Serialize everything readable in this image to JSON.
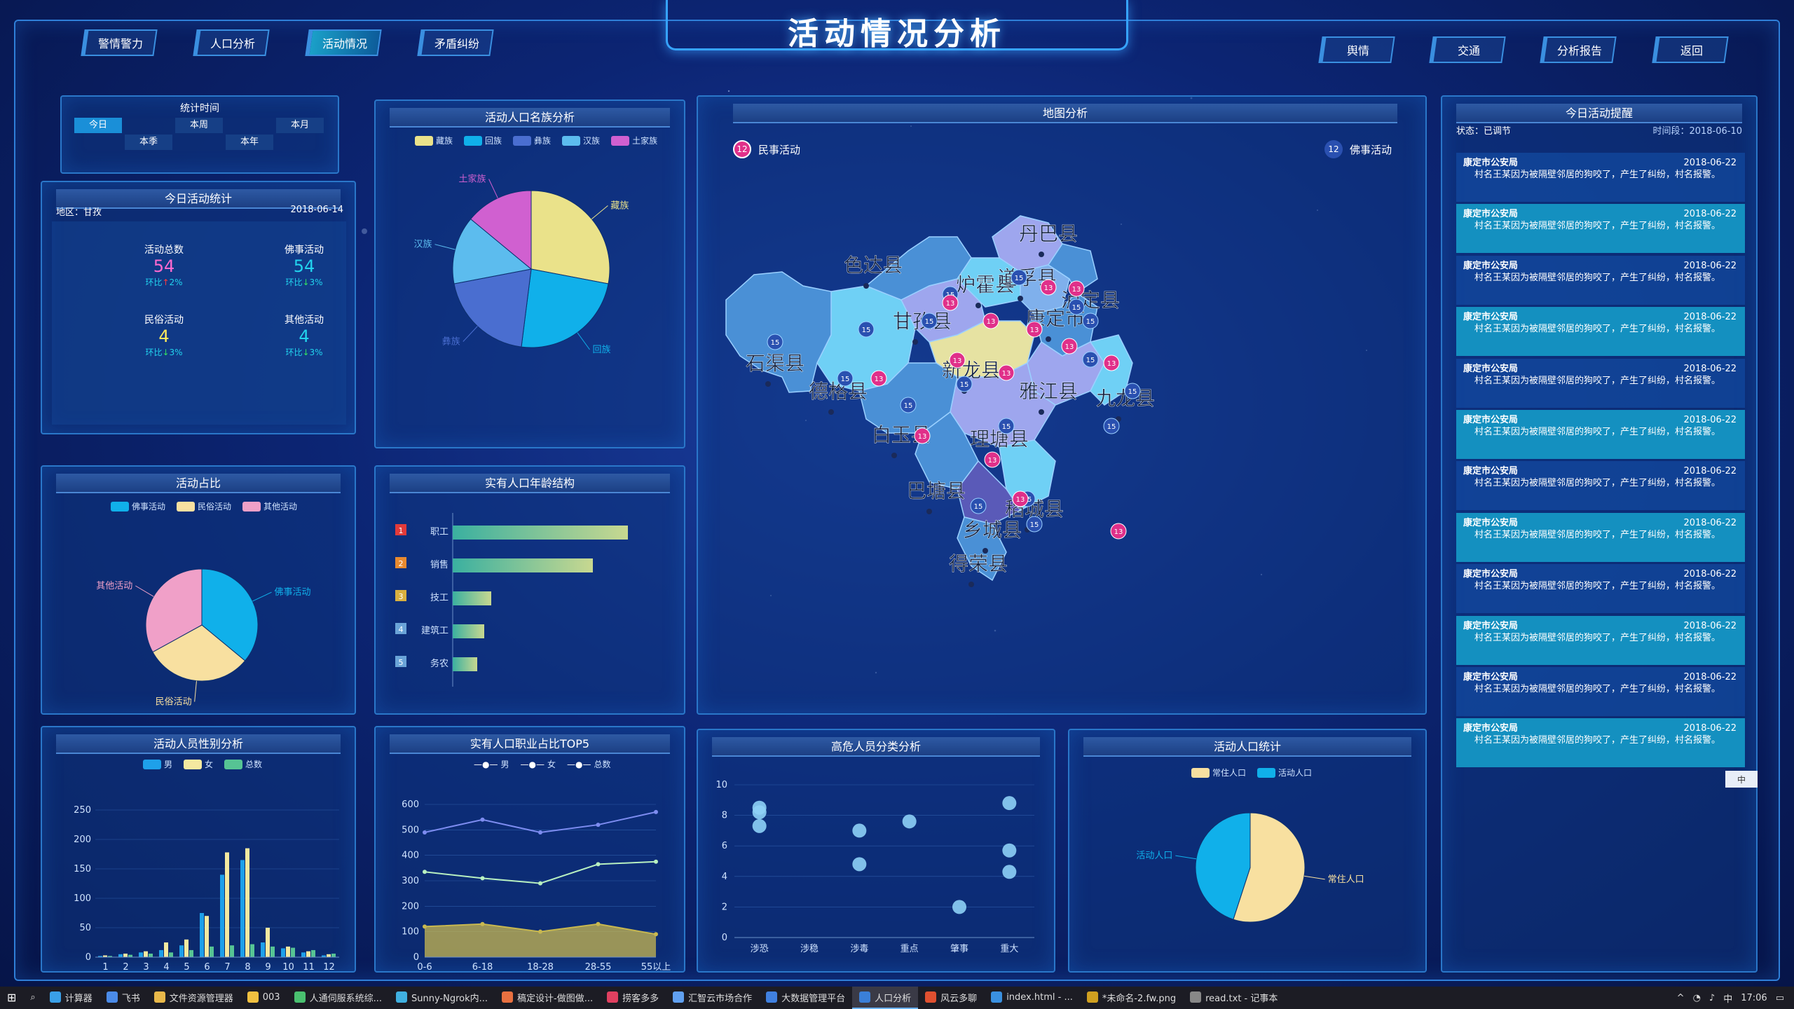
{
  "page_title": "活动情况分析",
  "nav_left": [
    "警情警力",
    "人口分析",
    "活动情况",
    "矛盾纠纷"
  ],
  "nav_active": "活动情况",
  "nav_right": [
    "舆情",
    "交通",
    "分析报告",
    "返回"
  ],
  "time_panel": {
    "title": "统计时间",
    "options": [
      "今日",
      "本周",
      "本月",
      "本季",
      "本年"
    ],
    "selected": "今日"
  },
  "today_stats": {
    "title": "今日活动统计",
    "region": "地区：甘孜",
    "date": "2018-06-14",
    "items": [
      {
        "label": "活动总数",
        "value": "54",
        "change": "环比",
        "pct": "2%",
        "dir": "up",
        "color": "#ff6ad0"
      },
      {
        "label": "佛事活动",
        "value": "54",
        "change": "环比",
        "pct": "3%",
        "dir": "down",
        "color": "#22d3ee"
      },
      {
        "label": "民俗活动",
        "value": "4",
        "change": "环比",
        "pct": "3%",
        "dir": "down",
        "color": "#ffea5c"
      },
      {
        "label": "其他活动",
        "value": "4",
        "change": "环比",
        "pct": "3%",
        "dir": "down",
        "color": "#22d3ee"
      }
    ]
  },
  "ethnic_panel": {
    "title": "活动人口名族分析"
  },
  "map_panel": {
    "title": "地图分析",
    "legend_left": {
      "count": "12",
      "label": "民事活动"
    },
    "legend_right": {
      "count": "12",
      "label": "佛事活动"
    },
    "counties": [
      "色达县",
      "丹巴县",
      "炉霍县",
      "道孚县",
      "泸定县",
      "康定市",
      "甘孜县",
      "石渠县",
      "新龙县",
      "德格县",
      "雅江县",
      "九龙县",
      "白玉县",
      "理塘县",
      "巴塘县",
      "稻城县",
      "乡城县",
      "得荣县"
    ],
    "badge_a": "15",
    "badge_b": "13"
  },
  "remind_panel": {
    "title": "今日活动提醒",
    "status": "状态：已调节",
    "time": "时间段：2018-06-10",
    "items": [
      {
        "org": "康定市公安局",
        "date": "2018-06-22",
        "text": "村名王某因为被隔壁邻居的狗咬了，产生了纠纷，村名报警。"
      },
      {
        "org": "康定市公安局",
        "date": "2018-06-22",
        "text": "村名王某因为被隔壁邻居的狗咬了，产生了纠纷，村名报警。"
      },
      {
        "org": "康定市公安局",
        "date": "2018-06-22",
        "text": "村名王某因为被隔壁邻居的狗咬了，产生了纠纷，村名报警。"
      },
      {
        "org": "康定市公安局",
        "date": "2018-06-22",
        "text": "村名王某因为被隔壁邻居的狗咬了，产生了纠纷，村名报警。"
      },
      {
        "org": "康定市公安局",
        "date": "2018-06-22",
        "text": "村名王某因为被隔壁邻居的狗咬了，产生了纠纷，村名报警。"
      },
      {
        "org": "康定市公安局",
        "date": "2018-06-22",
        "text": "村名王某因为被隔壁邻居的狗咬了，产生了纠纷，村名报警。"
      },
      {
        "org": "康定市公安局",
        "date": "2018-06-22",
        "text": "村名王某因为被隔壁邻居的狗咬了，产生了纠纷，村名报警。"
      },
      {
        "org": "康定市公安局",
        "date": "2018-06-22",
        "text": "村名王某因为被隔壁邻居的狗咬了，产生了纠纷，村名报警。"
      },
      {
        "org": "康定市公安局",
        "date": "2018-06-22",
        "text": "村名王某因为被隔壁邻居的狗咬了，产生了纠纷，村名报警。"
      },
      {
        "org": "康定市公安局",
        "date": "2018-06-22",
        "text": "村名王某因为被隔壁邻居的狗咬了，产生了纠纷，村名报警。"
      },
      {
        "org": "康定市公安局",
        "date": "2018-06-22",
        "text": "村名王某因为被隔壁邻居的狗咬了，产生了纠纷，村名报警。"
      },
      {
        "org": "康定市公安局",
        "date": "2018-06-22",
        "text": "村名王某因为被隔壁邻居的狗咬了，产生了纠纷，村名报警。"
      }
    ]
  },
  "ime_text": "中",
  "taskbar": {
    "items": [
      "计算器",
      "飞书",
      "文件资源管理器",
      "003",
      "人通伺服系统综...",
      "Sunny-Ngrok内...",
      "稿定设计-做图做...",
      "捞客多多",
      "汇智云市场合作",
      "大数据管理平台",
      "人口分析",
      "风云多聊",
      "index.html - ...",
      "*未命名-2.fw.png",
      "read.txt - 记事本"
    ],
    "active": "人口分析",
    "clock": "17:06",
    "tray_lang": "中"
  },
  "colors": {
    "pink": "#e060c8",
    "cyan": "#10b0ea",
    "yellow": "#eae28a",
    "blue": "#4a6ed0",
    "lightblue": "#5cbcee"
  },
  "chart_data": [
    {
      "type": "pie",
      "title": "活动人口名族分析",
      "legend": [
        "藏族",
        "回族",
        "彝族",
        "汉族",
        "土家族"
      ],
      "labels": [
        "藏族",
        "回族",
        "彝族",
        "汉族",
        "土家族"
      ],
      "values": [
        28,
        24,
        20,
        14,
        14
      ],
      "colors": [
        "#eae28a",
        "#10b0ea",
        "#4a6ed0",
        "#5cbcee",
        "#d060d0"
      ]
    },
    {
      "type": "pie",
      "title": "活动占比",
      "legend": [
        "佛事活动",
        "民俗活动",
        "其他活动"
      ],
      "labels": [
        "佛事活动",
        "民俗活动",
        "其他活动"
      ],
      "values": [
        36,
        31,
        33
      ],
      "colors": [
        "#10b0ea",
        "#f8e0a0",
        "#f0a0c8"
      ]
    },
    {
      "type": "bar",
      "title": "实有人口年龄结构",
      "categories": [
        "职工",
        "销售",
        "技工",
        "建筑工",
        "务农"
      ],
      "ranks": [
        "1",
        "2",
        "3",
        "4",
        "5"
      ],
      "values": [
        100,
        80,
        22,
        18,
        14
      ]
    },
    {
      "type": "bar",
      "title": "活动人员性别分析",
      "legend": [
        "男",
        "女",
        "总数"
      ],
      "categories": [
        "1",
        "2",
        "3",
        "4",
        "5",
        "6",
        "7",
        "8",
        "9",
        "10",
        "11",
        "12"
      ],
      "ylim": [
        0,
        250
      ],
      "yticks": [
        "0",
        "50",
        "100",
        "150",
        "200",
        "250"
      ],
      "series": [
        {
          "name": "男",
          "values": [
            2,
            5,
            8,
            12,
            20,
            75,
            140,
            165,
            25,
            15,
            8,
            3
          ],
          "color": "#1ea0ea"
        },
        {
          "name": "女",
          "values": [
            3,
            6,
            10,
            25,
            30,
            70,
            178,
            185,
            50,
            18,
            10,
            5
          ],
          "color": "#f4e9a0"
        },
        {
          "name": "总数",
          "values": [
            2,
            4,
            6,
            8,
            12,
            18,
            20,
            22,
            18,
            16,
            12,
            6
          ],
          "color": "#56c494"
        }
      ]
    },
    {
      "type": "line",
      "title": "实有人口职业占比TOP5",
      "legend": [
        "男",
        "女",
        "总数"
      ],
      "categories": [
        "0-6",
        "6-18",
        "18-28",
        "28-55",
        "55以上"
      ],
      "ylim": [
        0,
        600
      ],
      "yticks": [
        "0",
        "100",
        "200",
        "300",
        "400",
        "500",
        "600"
      ],
      "series": [
        {
          "name": "男",
          "values": [
            490,
            540,
            490,
            520,
            570
          ],
          "color": "#7d8cf0"
        },
        {
          "name": "女",
          "values": [
            335,
            310,
            290,
            365,
            375
          ],
          "color": "#b8f0c0"
        },
        {
          "name": "总数",
          "values": [
            120,
            130,
            100,
            130,
            90
          ],
          "color": "#c8b850"
        }
      ]
    },
    {
      "type": "scatter",
      "title": "高危人员分类分析",
      "categories": [
        "涉恐",
        "涉稳",
        "涉毒",
        "重点",
        "肇事",
        "重大"
      ],
      "ylim": [
        0,
        10
      ],
      "yticks": [
        "0",
        "2",
        "4",
        "6",
        "8",
        "10"
      ],
      "points": [
        [
          0,
          8.5
        ],
        [
          0,
          8.2
        ],
        [
          0,
          7.3
        ],
        [
          2,
          7.0
        ],
        [
          2,
          4.8
        ],
        [
          3,
          7.6
        ],
        [
          4,
          2.0
        ],
        [
          5,
          8.8
        ],
        [
          5,
          5.7
        ],
        [
          5,
          4.3
        ]
      ]
    },
    {
      "type": "pie",
      "title": "活动人口统计",
      "legend": [
        "常住人口",
        "活动人口"
      ],
      "labels": [
        "常住人口",
        "活动人口"
      ],
      "values": [
        55,
        45
      ],
      "colors": [
        "#f8e0a0",
        "#10b0ea"
      ]
    }
  ]
}
